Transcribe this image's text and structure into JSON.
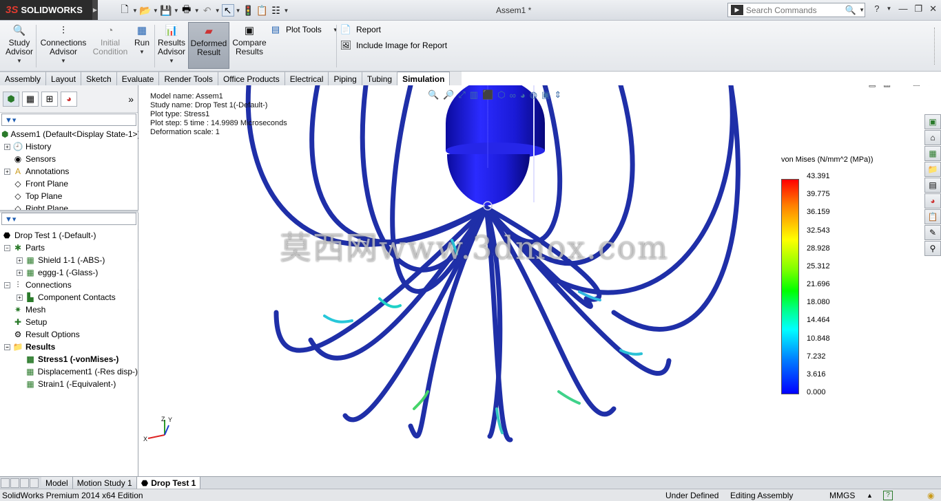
{
  "app": {
    "brand_ds": "3S",
    "brand_name": "SOLIDWORKS",
    "doc_title": "Assem1 *"
  },
  "search": {
    "placeholder": "Search Commands"
  },
  "ribbon": {
    "study_advisor": "Study Advisor",
    "connections_advisor": "Connections Advisor",
    "initial_condition": "Initial Condition",
    "run": "Run",
    "results_advisor": "Results Advisor",
    "deformed_result": "Deformed Result",
    "compare_results": "Compare Results",
    "plot_tools": "Plot Tools",
    "report": "Report",
    "include_image": "Include Image for Report"
  },
  "tabs": [
    "Assembly",
    "Layout",
    "Sketch",
    "Evaluate",
    "Render Tools",
    "Office Products",
    "Electrical",
    "Piping",
    "Tubing",
    "Simulation"
  ],
  "active_tab": "Simulation",
  "tree_top": {
    "root": "Assem1  (Default<Display State-1>)",
    "items": [
      "History",
      "Sensors",
      "Annotations",
      "Front Plane",
      "Top Plane",
      "Right Plane"
    ]
  },
  "tree_sim": {
    "study": "Drop Test 1 (-Default-)",
    "parts": "Parts",
    "part1": "Shield 1-1 (-ABS-)",
    "part2": "eggg-1 (-Glass-)",
    "connections": "Connections",
    "component_contacts": "Component Contacts",
    "mesh": "Mesh",
    "setup": "Setup",
    "result_options": "Result Options",
    "results": "Results",
    "stress": "Stress1 (-vonMises-)",
    "displacement": "Displacement1 (-Res disp-)",
    "strain": "Strain1 (-Equivalent-)"
  },
  "plot_info": {
    "model_name": "Model name: Assem1",
    "study_name": "Study name: Drop Test 1(-Default-)",
    "plot_type": "Plot type:  Stress1",
    "plot_step": "Plot step: 5   time : 14.9989 Microseconds",
    "deformation_scale": "Deformation scale: 1"
  },
  "watermark": "莫西网www.3dmox.com",
  "legend": {
    "title": "von Mises (N/mm^2 (MPa))",
    "values": [
      "43.391",
      "39.775",
      "36.159",
      "32.543",
      "28.928",
      "25.312",
      "21.696",
      "18.080",
      "14.464",
      "10.848",
      "7.232",
      "3.616",
      "0.000"
    ],
    "max_color": "#ff0000",
    "min_color": "#0000ff"
  },
  "bottom_tabs": [
    "Model",
    "Motion Study 1",
    "Drop Test 1"
  ],
  "active_bottom_tab": "Drop Test 1",
  "status": {
    "edition": "SolidWorks Premium 2014 x64 Edition",
    "defined": "Under Defined",
    "mode": "Editing Assembly",
    "units": "MMGS"
  },
  "colors": {
    "model_blue": "#1a1ad6",
    "shield_blue": "#1f2fa8"
  }
}
